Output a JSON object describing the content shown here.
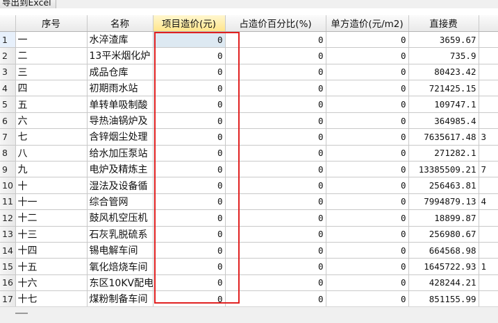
{
  "toolbar": {
    "export_label": "导出到Excel"
  },
  "columns": {
    "seq": "序号",
    "name": "名称",
    "project_cost": "项目造价(元)",
    "cost_percent": "占造价百分比(%)",
    "unit_cost": "单方造价(元/m2)",
    "direct_cost": "直接费"
  },
  "rows": [
    {
      "num": "1",
      "seq": "一",
      "name": "水淬渣库",
      "project_cost": "0",
      "cost_percent": "0",
      "unit_cost": "0",
      "direct_cost": "3659.67",
      "extra": ""
    },
    {
      "num": "2",
      "seq": "二",
      "name": "13平米烟化炉",
      "project_cost": "0",
      "cost_percent": "0",
      "unit_cost": "0",
      "direct_cost": "735.9",
      "extra": ""
    },
    {
      "num": "3",
      "seq": "三",
      "name": "成品仓库",
      "project_cost": "0",
      "cost_percent": "0",
      "unit_cost": "0",
      "direct_cost": "80423.42",
      "extra": ""
    },
    {
      "num": "4",
      "seq": "四",
      "name": "初期雨水站",
      "project_cost": "0",
      "cost_percent": "0",
      "unit_cost": "0",
      "direct_cost": "721425.15",
      "extra": ""
    },
    {
      "num": "5",
      "seq": "五",
      "name": "单转单吸制酸",
      "project_cost": "0",
      "cost_percent": "0",
      "unit_cost": "0",
      "direct_cost": "109747.1",
      "extra": ""
    },
    {
      "num": "6",
      "seq": "六",
      "name": "导热油锅炉及",
      "project_cost": "0",
      "cost_percent": "0",
      "unit_cost": "0",
      "direct_cost": "364985.4",
      "extra": ""
    },
    {
      "num": "7",
      "seq": "七",
      "name": "含锌烟尘处理",
      "project_cost": "0",
      "cost_percent": "0",
      "unit_cost": "0",
      "direct_cost": "7635617.48",
      "extra": "3"
    },
    {
      "num": "8",
      "seq": "八",
      "name": "给水加压泵站",
      "project_cost": "0",
      "cost_percent": "0",
      "unit_cost": "0",
      "direct_cost": "271282.1",
      "extra": ""
    },
    {
      "num": "9",
      "seq": "九",
      "name": "电炉及精炼主",
      "project_cost": "0",
      "cost_percent": "0",
      "unit_cost": "0",
      "direct_cost": "13385509.21",
      "extra": "7"
    },
    {
      "num": "10",
      "seq": "十",
      "name": "湿法及设备循",
      "project_cost": "0",
      "cost_percent": "0",
      "unit_cost": "0",
      "direct_cost": "256463.81",
      "extra": ""
    },
    {
      "num": "11",
      "seq": "十一",
      "name": "综合管网",
      "project_cost": "0",
      "cost_percent": "0",
      "unit_cost": "0",
      "direct_cost": "7994879.13",
      "extra": "4"
    },
    {
      "num": "12",
      "seq": "十二",
      "name": "鼓风机空压机",
      "project_cost": "0",
      "cost_percent": "0",
      "unit_cost": "0",
      "direct_cost": "18899.87",
      "extra": ""
    },
    {
      "num": "13",
      "seq": "十三",
      "name": "石灰乳脱硫系",
      "project_cost": "0",
      "cost_percent": "0",
      "unit_cost": "0",
      "direct_cost": "256980.67",
      "extra": ""
    },
    {
      "num": "14",
      "seq": "十四",
      "name": "锡电解车间",
      "project_cost": "0",
      "cost_percent": "0",
      "unit_cost": "0",
      "direct_cost": "664568.98",
      "extra": ""
    },
    {
      "num": "15",
      "seq": "十五",
      "name": "氧化焙烧车间",
      "project_cost": "0",
      "cost_percent": "0",
      "unit_cost": "0",
      "direct_cost": "1645722.93",
      "extra": "1"
    },
    {
      "num": "16",
      "seq": "十六",
      "name": "东区10KV配电",
      "project_cost": "0",
      "cost_percent": "0",
      "unit_cost": "0",
      "direct_cost": "428244.21",
      "extra": ""
    },
    {
      "num": "17",
      "seq": "十七",
      "name": "煤粉制备车间",
      "project_cost": "0",
      "cost_percent": "0",
      "unit_cost": "0",
      "direct_cost": "851155.99",
      "extra": ""
    }
  ],
  "colors": {
    "highlight_box": "#e02020",
    "active_header": "#ffe58a",
    "selected_cell": "#dde9f2"
  }
}
